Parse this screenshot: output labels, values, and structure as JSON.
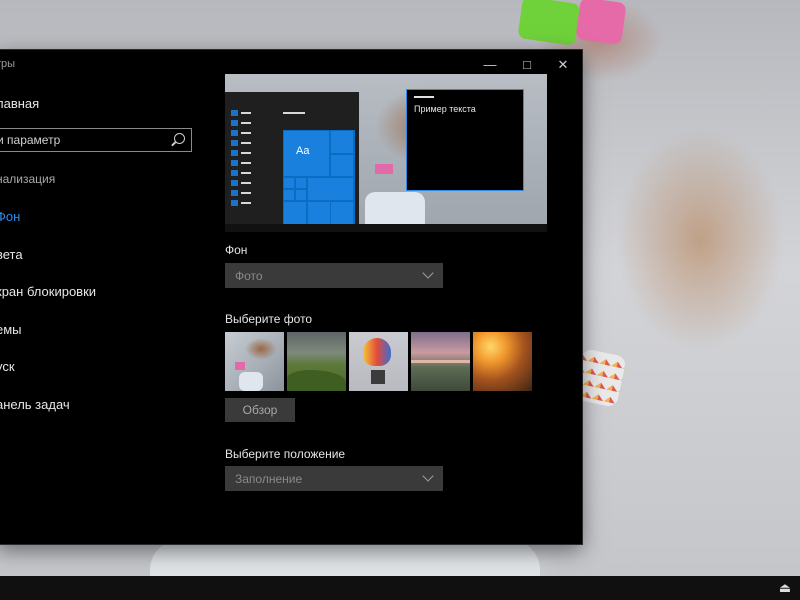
{
  "window": {
    "title": "тры",
    "controls": [
      "—",
      "□",
      "✕"
    ]
  },
  "sidebar": {
    "home": "лавная",
    "search_placeholder": "и параметр",
    "section": "нализация",
    "items": [
      "Фон",
      "вета",
      "кран блокировки",
      "емы",
      "уск",
      "анель задач"
    ],
    "active_index": 0
  },
  "preview": {
    "sample_text": "Пример текста",
    "tile_text": "Aa"
  },
  "background": {
    "label": "Фон",
    "value": "Фото"
  },
  "photos": {
    "label": "Выберите фото",
    "browse_label": "Обзор",
    "thumbnails": [
      "dancer-photo",
      "green-hills-photo",
      "hot-air-balloon-photo",
      "lake-sunset-photo",
      "sunset-rocks-photo"
    ]
  },
  "position": {
    "label": "Выберите положение",
    "value": "Заполнение"
  },
  "colors": {
    "accent": "#2e8be6",
    "window_bg": "#000000",
    "control_bg": "#3a3a3a"
  }
}
